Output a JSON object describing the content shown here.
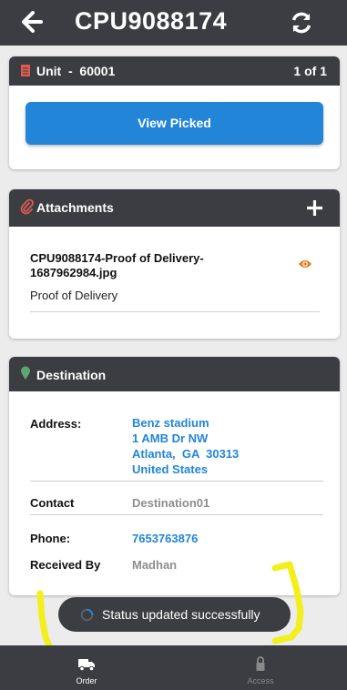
{
  "header": {
    "title": "CPU9088174"
  },
  "unit": {
    "label": "Unit  -  60001",
    "pager": "1 of 1",
    "button": "View Picked"
  },
  "attachments": {
    "title": "Attachments",
    "file_name": "CPU9088174-Proof of Delivery-1687962984.jpg",
    "file_desc": "Proof of Delivery"
  },
  "destination": {
    "title": "Destination",
    "address_label": "Address:",
    "address_lines": [
      "Benz stadium",
      "1 AMB Dr NW",
      "Atlanta,  GA  30313",
      "United States"
    ],
    "contact_label": "Contact",
    "contact_value": "Destination01",
    "phone_label": "Phone:",
    "phone_value": "7653763876",
    "received_label": "Received By",
    "received_value": "Madhan"
  },
  "toast": {
    "text": "Status updated successfully"
  },
  "tabs": [
    {
      "label": "Order",
      "color": "#ffffff"
    },
    {
      "label": "Access",
      "color": "#8a8a8a"
    }
  ],
  "colors": {
    "accent": "#2385d7",
    "header": "#3b3d42",
    "attachment_icon": "#e05b4f",
    "eye_icon": "#e87a1e",
    "highlight": "#f2ef1c"
  }
}
